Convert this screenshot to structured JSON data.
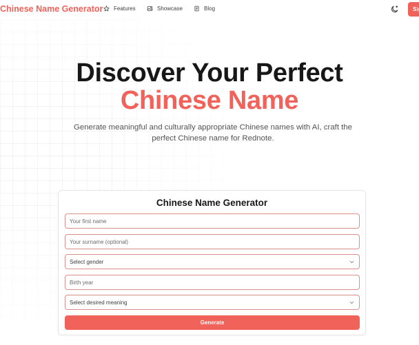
{
  "header": {
    "brand": "Chinese Name Generator",
    "nav": [
      {
        "label": "Features",
        "icon": "star-icon"
      },
      {
        "label": "Showcase",
        "icon": "image-icon"
      },
      {
        "label": "Blog",
        "icon": "document-icon"
      }
    ],
    "theme_icon": "moon-sparkle-icon",
    "signin_label": "Sign In"
  },
  "hero": {
    "title_line1": "Discover Your Perfect",
    "title_line2": "Chinese Name",
    "subtitle": "Generate meaningful and culturally appropriate Chinese names with AI, craft the perfect Chinese name for Rednote."
  },
  "form": {
    "title": "Chinese Name Generator",
    "first_name_placeholder": "Your first name",
    "surname_placeholder": "Your surname (optional)",
    "gender_selected": "Select gender",
    "birth_year_placeholder": "Birth year",
    "meaning_selected": "Select desired meaning",
    "generate_label": "Generate"
  },
  "colors": {
    "accent": "#f0625a",
    "field_border": "#d9908b",
    "text_dark": "#171717",
    "text_muted": "#525252"
  }
}
